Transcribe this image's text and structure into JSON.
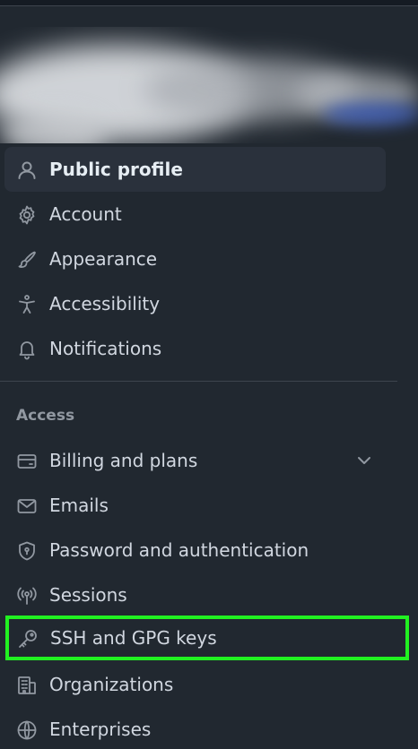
{
  "nav": {
    "items": [
      {
        "label": "Public profile",
        "icon": "person-icon",
        "selected": true
      },
      {
        "label": "Account",
        "icon": "gear-icon"
      },
      {
        "label": "Appearance",
        "icon": "paintbrush-icon"
      },
      {
        "label": "Accessibility",
        "icon": "accessibility-icon"
      },
      {
        "label": "Notifications",
        "icon": "bell-icon"
      }
    ],
    "access_heading": "Access",
    "access_items": [
      {
        "label": "Billing and plans",
        "icon": "credit-card-icon",
        "expandable": true
      },
      {
        "label": "Emails",
        "icon": "mail-icon"
      },
      {
        "label": "Password and authentication",
        "icon": "shield-lock-icon"
      },
      {
        "label": "Sessions",
        "icon": "broadcast-icon"
      },
      {
        "label": "SSH and GPG keys",
        "icon": "key-icon",
        "highlighted": true,
        "highlight_color": "#21f121"
      },
      {
        "label": "Organizations",
        "icon": "organization-icon"
      },
      {
        "label": "Enterprises",
        "icon": "globe-icon"
      }
    ]
  },
  "colors": {
    "background": "#212830",
    "selected_background": "#2a313c",
    "text": "#d1d7e0",
    "muted_text": "#9198a1",
    "divider": "#3d444d"
  }
}
